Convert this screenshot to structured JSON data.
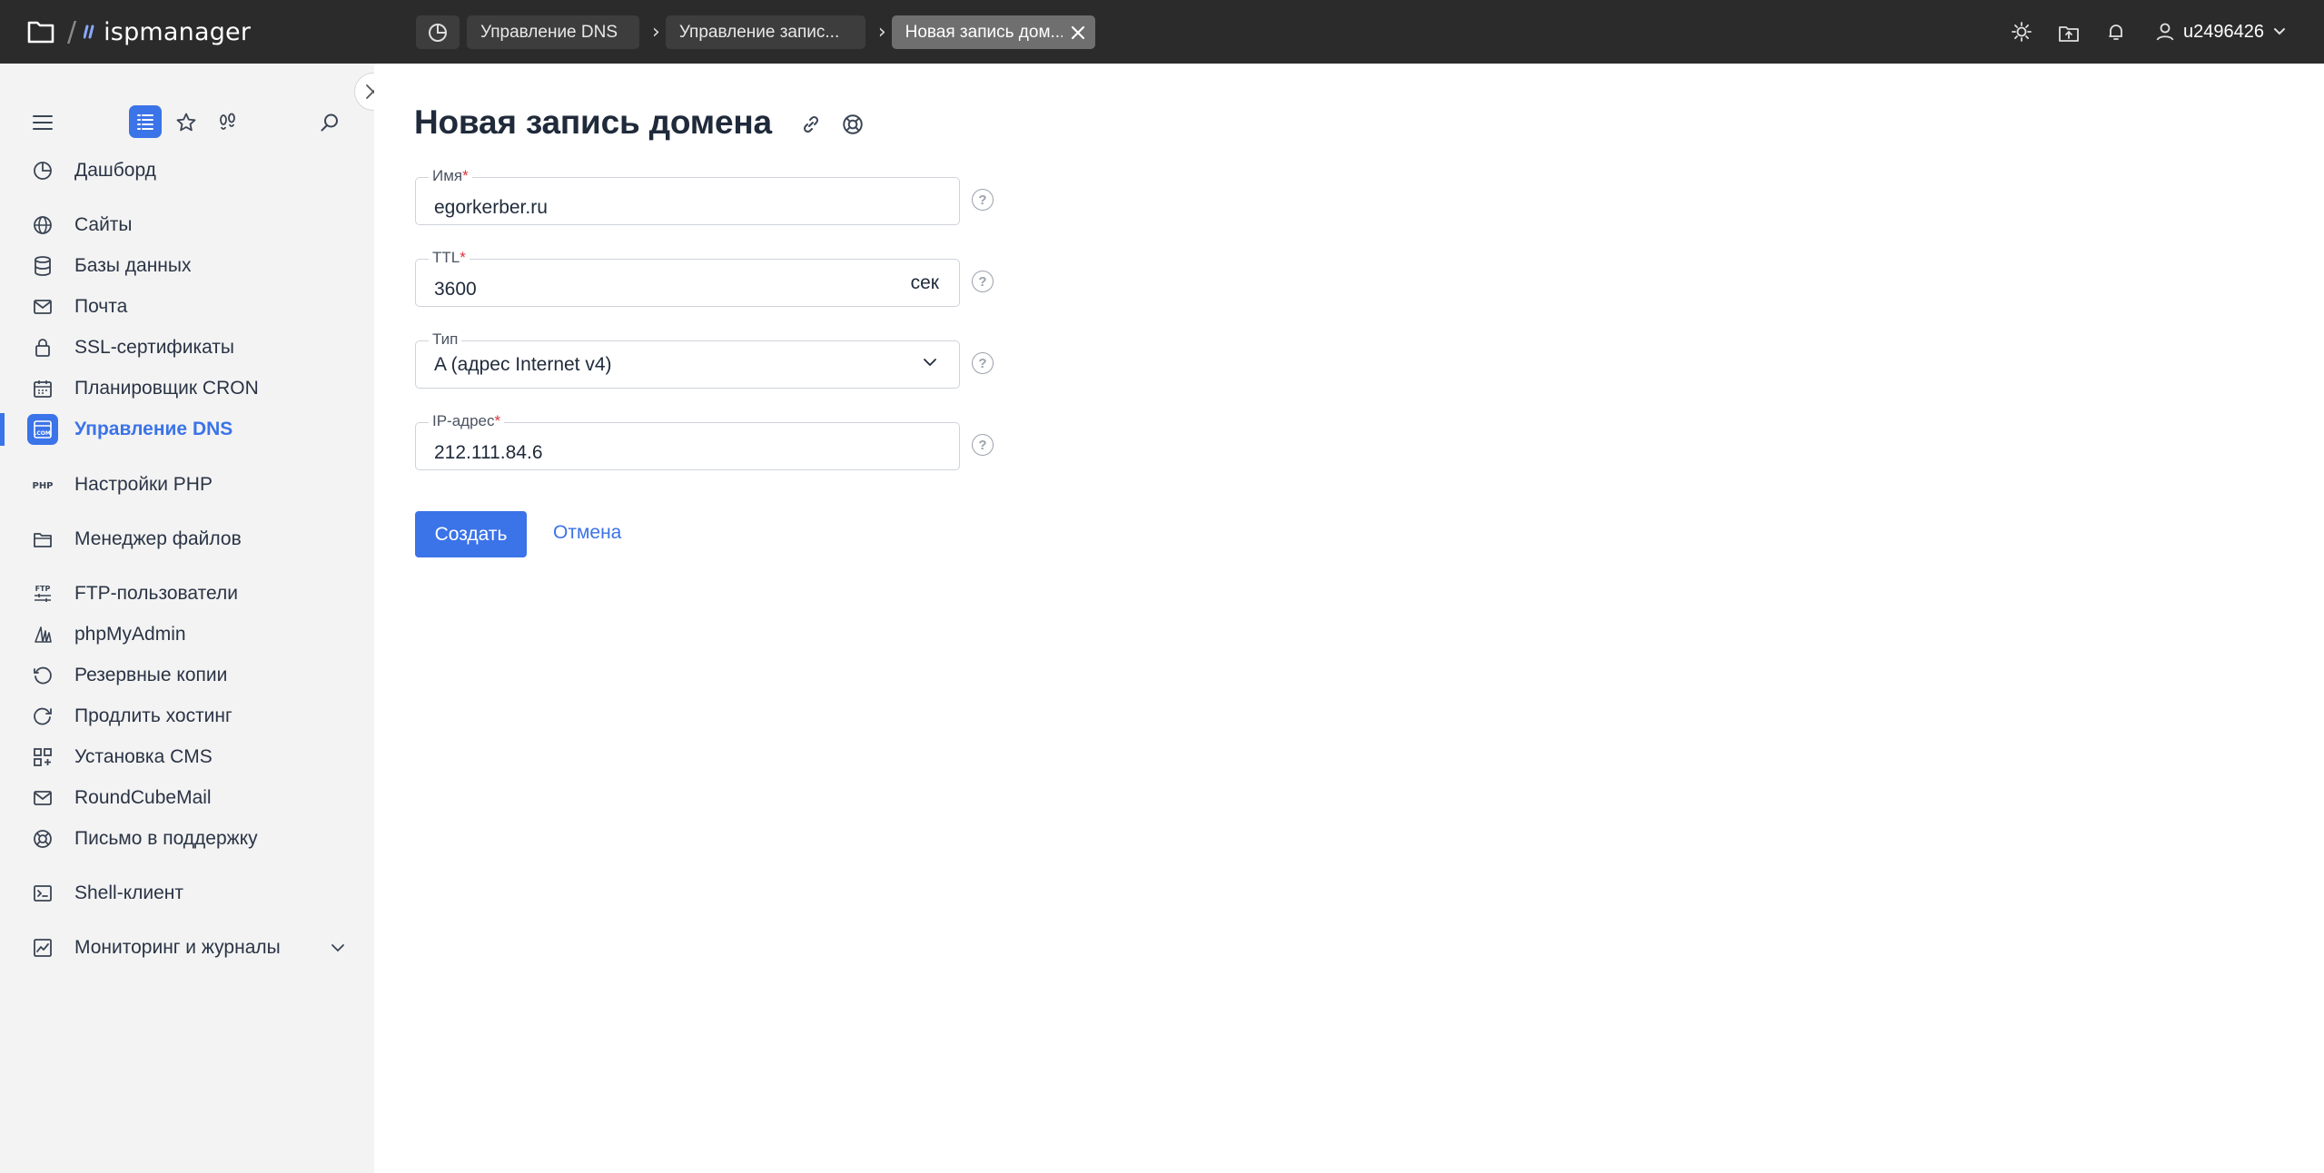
{
  "app": {
    "brand": "ispmanager",
    "separator": "/"
  },
  "breadcrumbs": [
    {
      "label": "Управление DNS"
    },
    {
      "label": "Управление запис..."
    },
    {
      "label": "Новая запись дом..."
    }
  ],
  "topbar": {
    "username": "u2496426"
  },
  "sidebar": {
    "items": [
      {
        "label": "Дашборд",
        "icon": "dashboard-icon"
      },
      {
        "label": "Сайты",
        "icon": "globe-icon"
      },
      {
        "label": "Базы данных",
        "icon": "database-icon"
      },
      {
        "label": "Почта",
        "icon": "mail-icon"
      },
      {
        "label": "SSL-сертификаты",
        "icon": "lock-icon"
      },
      {
        "label": "Планировщик CRON",
        "icon": "calendar-icon"
      },
      {
        "label": "Управление DNS",
        "icon": "dns-icon",
        "active": true
      },
      {
        "label": "Настройки PHP",
        "icon": "php-icon"
      },
      {
        "label": "Менеджер файлов",
        "icon": "folder-icon"
      },
      {
        "label": "FTP-пользователи",
        "icon": "ftp-icon"
      },
      {
        "label": "phpMyAdmin",
        "icon": "phpmyadmin-icon"
      },
      {
        "label": "Резервные копии",
        "icon": "backup-icon"
      },
      {
        "label": "Продлить хостинг",
        "icon": "renew-icon"
      },
      {
        "label": "Установка CMS",
        "icon": "apps-icon"
      },
      {
        "label": "RoundCubeMail",
        "icon": "mail-icon"
      },
      {
        "label": "Письмо в поддержку",
        "icon": "lifebuoy-icon"
      },
      {
        "label": "Shell-клиент",
        "icon": "terminal-icon"
      },
      {
        "label": "Мониторинг и журналы",
        "icon": "chart-icon"
      }
    ]
  },
  "form": {
    "title": "Новая запись домена",
    "name": {
      "label": "Имя",
      "required": "*",
      "value": "egorkerber.ru"
    },
    "ttl": {
      "label": "TTL",
      "required": "*",
      "value": "3600",
      "unit": "сек"
    },
    "type": {
      "label": "Тип",
      "value": "A (адрес Internet v4)"
    },
    "ip": {
      "label": "IP-адрес",
      "required": "*",
      "value": "212.111.84.6"
    },
    "hint_symbol": "?",
    "submit_label": "Создать",
    "cancel_label": "Отмена"
  },
  "colors": {
    "accent": "#3b73e8",
    "topbar": "#2b2b2b",
    "sidebar": "#f3f3f3",
    "required": "#e0323c"
  }
}
